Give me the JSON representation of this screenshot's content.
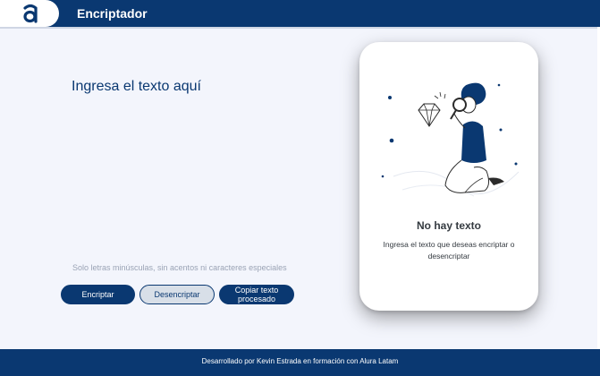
{
  "header": {
    "title": "Encriptador",
    "logo_icon": "alura-logo-icon"
  },
  "input": {
    "placeholder": "Ingresa el texto aquí",
    "value": ""
  },
  "hint": "Solo letras minúsculas, sin acentos ni caracteres especiales",
  "buttons": {
    "encrypt": "Encriptar",
    "decrypt": "Desencriptar",
    "copy": "Copiar texto procesado"
  },
  "output": {
    "illustration": "person-with-magnifier-and-diamond",
    "title": "No hay texto",
    "message": "Ingresa el texto que deseas encriptar o desencriptar"
  },
  "footer": {
    "text": "Desarrollado por Kevin Estrada en formación con Alura Latam"
  },
  "colors": {
    "primary": "#0a3871",
    "background": "#f3f5fc",
    "secondary_button": "#d8dfe8"
  }
}
